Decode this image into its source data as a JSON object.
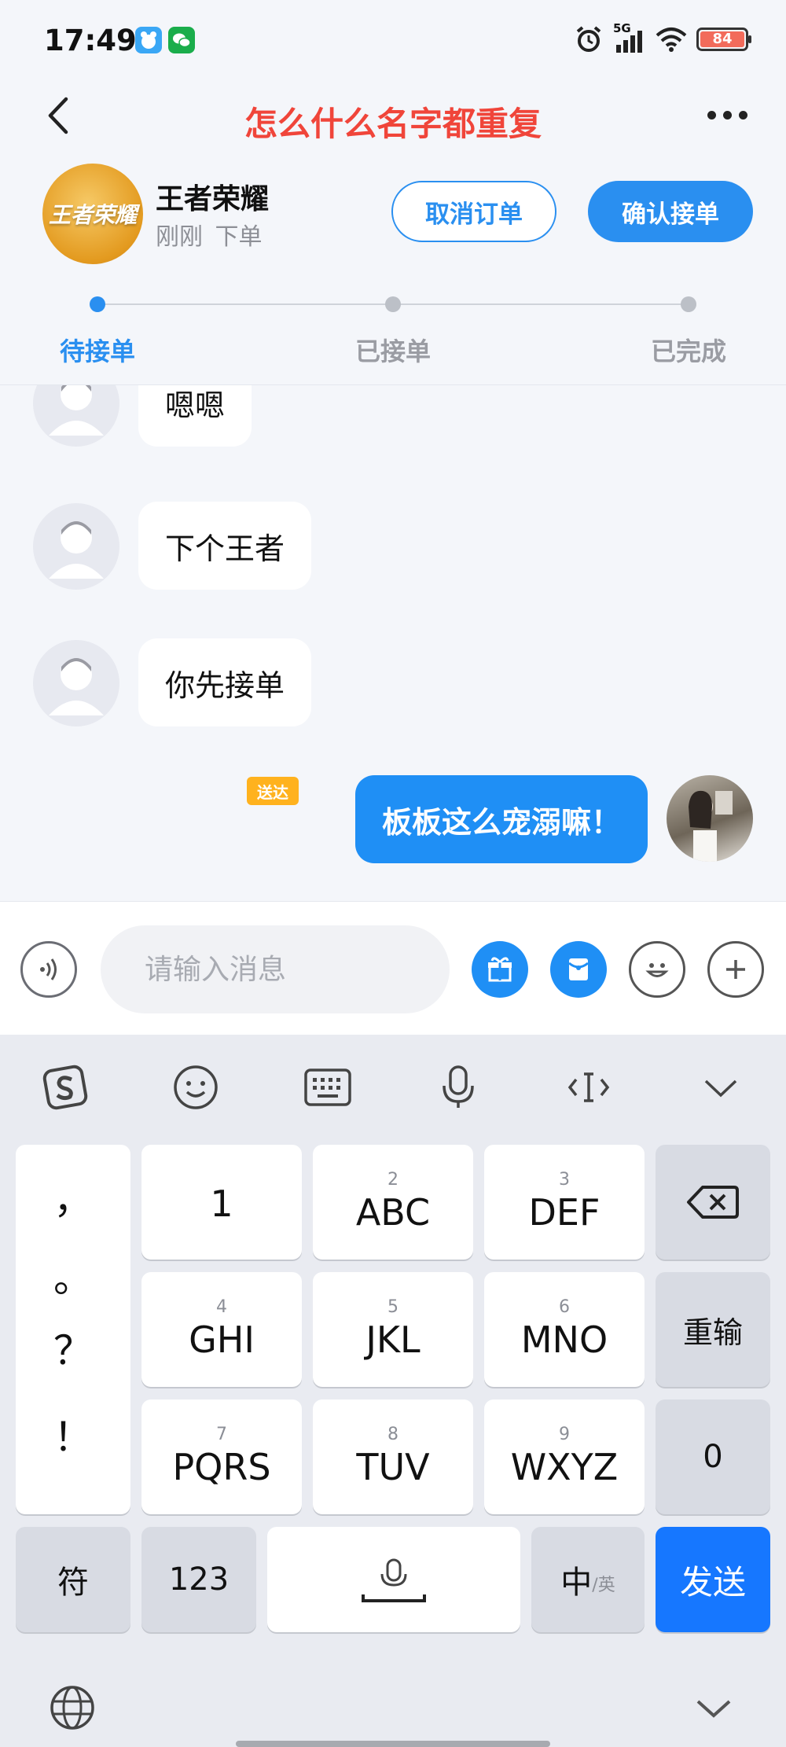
{
  "status_bar": {
    "time": "17:49",
    "network": "5G",
    "battery": "84"
  },
  "nav": {
    "title": "怎么什么名字都重复"
  },
  "order": {
    "game_name": "王者荣耀",
    "avatar_text": "王者荣耀",
    "time": "刚刚",
    "status": "下单",
    "cancel_label": "取消订单",
    "confirm_label": "确认接单",
    "steps": [
      "待接单",
      "已接单",
      "已完成"
    ]
  },
  "messages": [
    {
      "text": "嗯嗯",
      "from": "other"
    },
    {
      "text": "下个王者",
      "from": "other"
    },
    {
      "text": "你先接单",
      "from": "other"
    },
    {
      "text": "板板这么宠溺嘛！",
      "from": "me",
      "tag": "送达"
    }
  ],
  "input": {
    "placeholder": "请输入消息"
  },
  "keyboard": {
    "punct": [
      "，",
      "。",
      "？",
      "！"
    ],
    "keys": [
      {
        "num": "",
        "label": "1"
      },
      {
        "num": "2",
        "label": "ABC"
      },
      {
        "num": "3",
        "label": "DEF"
      },
      {
        "num": "4",
        "label": "GHI"
      },
      {
        "num": "5",
        "label": "JKL"
      },
      {
        "num": "6",
        "label": "MNO"
      },
      {
        "num": "7",
        "label": "PQRS"
      },
      {
        "num": "8",
        "label": "TUV"
      },
      {
        "num": "9",
        "label": "WXYZ"
      }
    ],
    "reinput_label": "重输",
    "zero_label": "0",
    "symbol_label": "符",
    "num_label": "123",
    "lang_main": "中",
    "lang_sub": "/英",
    "send_label": "发送"
  },
  "colors": {
    "accent": "#2a8ff0",
    "title_red": "#f0453a",
    "send_blue": "#1677ff",
    "tag_orange": "#ffb21e"
  }
}
